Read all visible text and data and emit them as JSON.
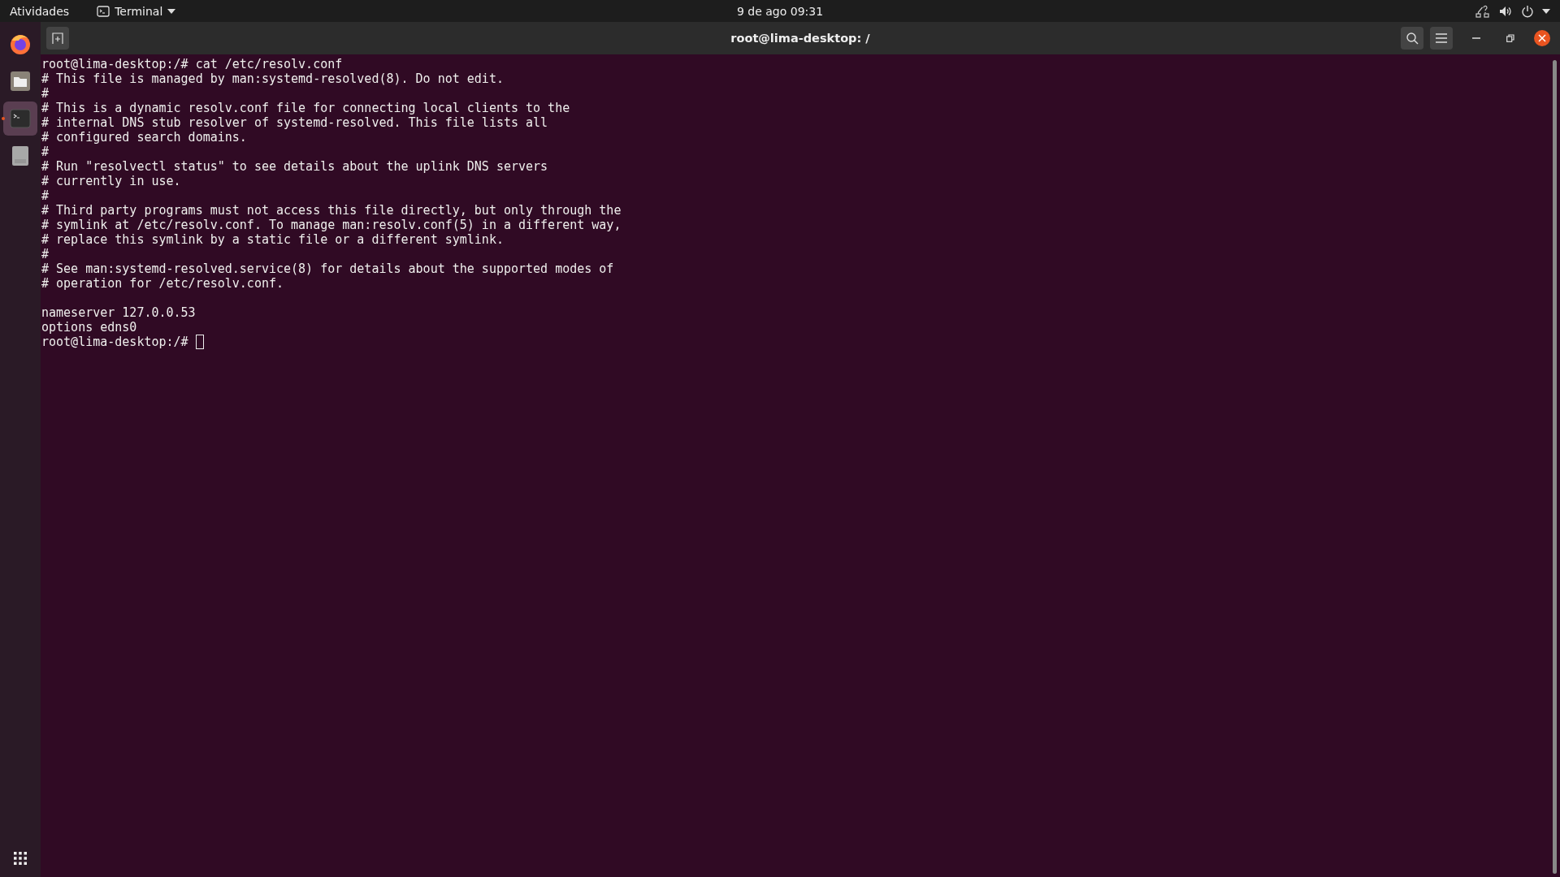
{
  "top_bar": {
    "activities": "Atividades",
    "app_menu": "Terminal",
    "clock": "9 de ago  09:31"
  },
  "dock": {
    "items": [
      {
        "kind": "firefox",
        "selected": false,
        "running": false
      },
      {
        "kind": "files",
        "selected": false,
        "running": false
      },
      {
        "kind": "terminal",
        "selected": true,
        "running": true
      },
      {
        "kind": "drive",
        "selected": false,
        "running": false
      }
    ]
  },
  "window": {
    "title": "root@lima-desktop: /"
  },
  "terminal": {
    "lines": [
      {
        "kind": "text",
        "text": "root@lima-desktop:/# cat /etc/resolv.conf"
      },
      {
        "kind": "text",
        "text": "# This file is managed by man:systemd-resolved(8). Do not edit."
      },
      {
        "kind": "text",
        "text": "#"
      },
      {
        "kind": "text",
        "text": "# This is a dynamic resolv.conf file for connecting local clients to the"
      },
      {
        "kind": "text",
        "text": "# internal DNS stub resolver of systemd-resolved. This file lists all"
      },
      {
        "kind": "text",
        "text": "# configured search domains."
      },
      {
        "kind": "text",
        "text": "#"
      },
      {
        "kind": "text",
        "text": "# Run \"resolvectl status\" to see details about the uplink DNS servers"
      },
      {
        "kind": "text",
        "text": "# currently in use."
      },
      {
        "kind": "text",
        "text": "#"
      },
      {
        "kind": "text",
        "text": "# Third party programs must not access this file directly, but only through the"
      },
      {
        "kind": "text",
        "text": "# symlink at /etc/resolv.conf. To manage man:resolv.conf(5) in a different way,"
      },
      {
        "kind": "text",
        "text": "# replace this symlink by a static file or a different symlink."
      },
      {
        "kind": "text",
        "text": "#"
      },
      {
        "kind": "text",
        "text": "# See man:systemd-resolved.service(8) for details about the supported modes of"
      },
      {
        "kind": "text",
        "text": "# operation for /etc/resolv.conf."
      },
      {
        "kind": "blank"
      },
      {
        "kind": "text",
        "text": "nameserver 127.0.0.53"
      },
      {
        "kind": "text",
        "text": "options edns0"
      },
      {
        "kind": "prompt",
        "text": "root@lima-desktop:/# "
      }
    ]
  }
}
